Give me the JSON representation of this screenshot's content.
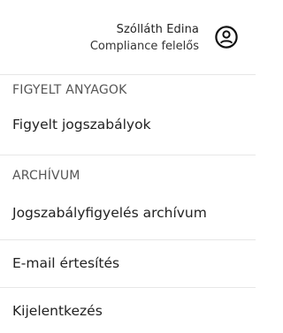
{
  "user": {
    "name": "Szólláth Edina",
    "role": "Compliance felelős",
    "avatar_icon": "user-circle-icon"
  },
  "sections": {
    "watched": {
      "title": "FIGYELT ANYAGOK",
      "item": "Figyelt jogszabályok"
    },
    "archive": {
      "title": "ARCHÍVUM",
      "item": "Jogszabályfigyelés archívum"
    }
  },
  "items": {
    "email": "E-mail értesítés",
    "logout": "Kijelentkezés"
  }
}
